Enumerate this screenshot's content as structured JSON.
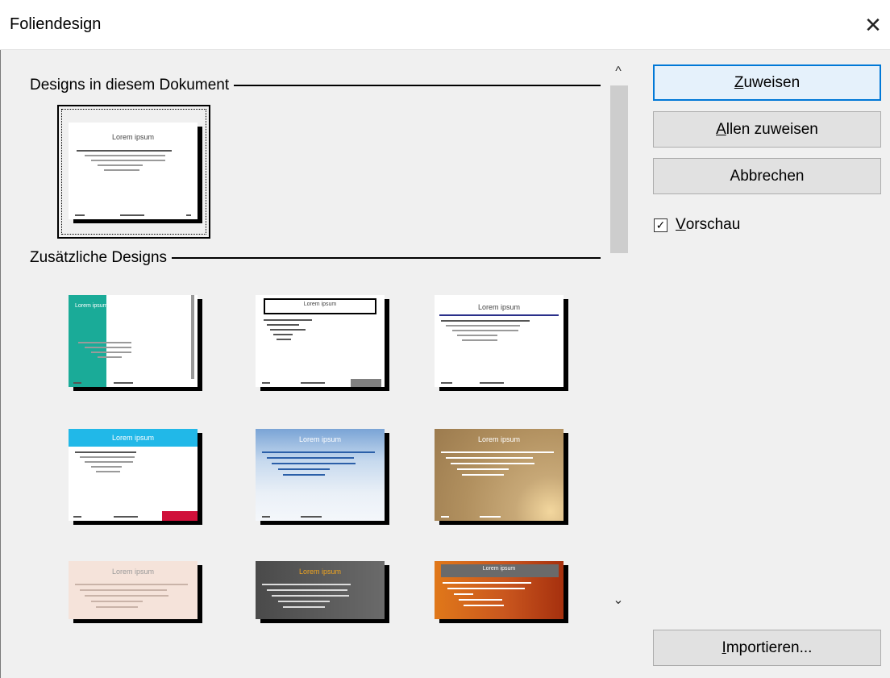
{
  "dialog": {
    "title": "Foliendesign",
    "close_icon": "close-icon"
  },
  "sections": {
    "current": "Designs in diesem Dokument",
    "additional": "Zusätzliche Designs"
  },
  "current_design": {
    "title": "Lorem ipsum"
  },
  "additional_designs": [
    {
      "title": "Lorem ipsum"
    },
    {
      "title": "Lorem ipsum"
    },
    {
      "title": "Lorem ipsum"
    },
    {
      "title": "Lorem ipsum"
    },
    {
      "title": "Lorem ipsum"
    },
    {
      "title": "Lorem ipsum"
    },
    {
      "title": "Lorem ipsum"
    },
    {
      "title": "Lorem ipsum"
    },
    {
      "title": "Lorem ipsum"
    }
  ],
  "buttons": {
    "assign_mnemonic": "Z",
    "assign_rest": "uweisen",
    "assign_all_mnemonic": "A",
    "assign_all_rest": "llen zuweisen",
    "cancel": "Abbrechen",
    "import_mnemonic": "I",
    "import_rest": "mportieren..."
  },
  "preview": {
    "checked": true,
    "mnemonic": "V",
    "rest": "orschau",
    "check_glyph": "✓"
  },
  "scrollbar": {
    "up": "^",
    "down": "⌄"
  },
  "colors": {
    "accent": "#0078d7",
    "teal": "#1aab98",
    "cyan": "#21b8e8",
    "red": "#d0103a",
    "navy": "#2a2f8a"
  }
}
